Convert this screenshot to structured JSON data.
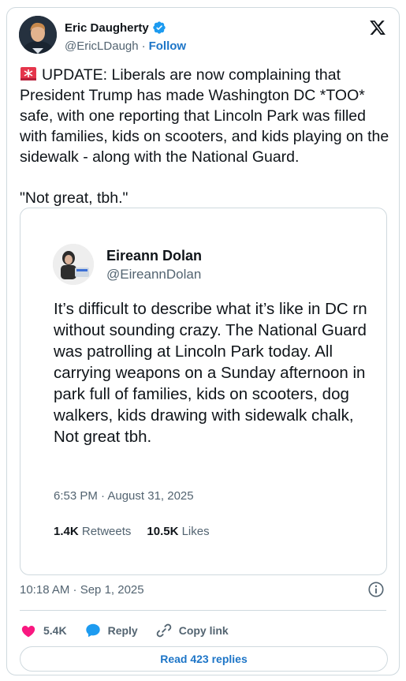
{
  "author": {
    "name": "Eric Daugherty",
    "handle": "@EricLDaugh",
    "separator": "·",
    "follow_label": "Follow"
  },
  "tweet": {
    "text": "UPDATE: Liberals are now complaining that President Trump has made Washington DC *TOO* safe, with one reporting that Lincoln Park was filled with families, kids on scooters, and kids playing on the sidewalk - along with the National Guard.\n\n\"Not great, tbh.\"",
    "leading_icon": "siren-emoji-icon",
    "timestamp": "10:18 AM · Sep 1, 2025"
  },
  "quoted": {
    "name": "Eireann Dolan",
    "handle": "@EireannDolan",
    "text": "It’s difficult to describe what it’s like in DC rn without sounding crazy. The National Guard was patrolling at Lincoln Park today. All carrying weapons on a Sunday afternoon in park full of families, kids on scooters, dog walkers, kids drawing with sidewalk chalk, Not great tbh.",
    "timestamp": "6:53 PM · August 31, 2025",
    "retweets_count": "1.4K",
    "retweets_label": "Retweets",
    "likes_count": "10.5K",
    "likes_label": "Likes"
  },
  "actions": {
    "like_count": "5.4K",
    "reply_label": "Reply",
    "copy_link_label": "Copy link"
  },
  "read_replies_label": "Read 423 replies",
  "colors": {
    "link_blue": "#1d75c7",
    "like_pink": "#f91880",
    "reply_blue": "#1d9bf0",
    "verified_blue": "#1d9bf0"
  }
}
